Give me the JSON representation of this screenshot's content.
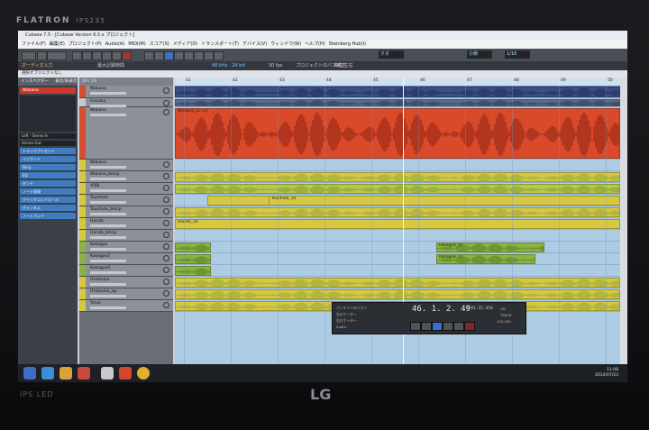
{
  "bezel": {
    "brand": "FLATRON",
    "model": "IPS235",
    "lower_left": "IPS LED",
    "logo": "LG"
  },
  "window": {
    "title": "Cubase 7.5 - [Cubase Version 6.5.x プロジェクト]"
  },
  "menu": [
    "ファイル(F)",
    "編集(E)",
    "プロジェクト(P)",
    "Audio(A)",
    "MIDI(M)",
    "スコア(S)",
    "メディア(D)",
    "トランスポート(T)",
    "デバイス(V)",
    "ウィンドウ(W)",
    "ヘルプ(H)",
    "Steinberg Hub(I)"
  ],
  "toolbar": {
    "snap": "クオ",
    "quantize": "1/16",
    "tempo_mode": "小節"
  },
  "infobar": {
    "record_label": "オーディオ入力",
    "rate": "48 kHz - 24 bit",
    "fps": "30 fps",
    "status1": "最大記録時間",
    "status2": "プロジェクトのパン補正",
    "status3": "等位/左右"
  },
  "statusline": "選択オブジェクトなし",
  "inspector": {
    "header": "インスペクター",
    "tab": "表示/非表示",
    "track": "Wakana",
    "slots": [
      "Left - Stereo In",
      "Stereo Out"
    ],
    "sections": [
      "トラックプリセット",
      "インサート",
      "Strip",
      "EQ",
      "センド",
      "ノート表現",
      "クイックコントロール",
      "チャンネル",
      "ノートパッド"
    ]
  },
  "tracklist": {
    "header": "29 / 29"
  },
  "tracks": [
    {
      "name": "Wakana",
      "color": "#d44d2e",
      "h": 14
    },
    {
      "name": "Inacaku",
      "color": "#c9c9c9",
      "h": 10
    },
    {
      "name": "Wakana",
      "color": "#d44d2e",
      "h": 58
    },
    {
      "name": "Wakana",
      "color": "#d6c843",
      "h": 13
    },
    {
      "name": "Wakana_bmsp",
      "color": "#d6c843",
      "h": 13
    },
    {
      "name": "YOBI",
      "color": "#d6c843",
      "h": 13
    },
    {
      "name": "Touchida",
      "color": "#d6c843",
      "h": 13
    },
    {
      "name": "Touchida_bmsp",
      "color": "#d6c843",
      "h": 13
    },
    {
      "name": "Honda",
      "color": "#d6c843",
      "h": 13
    },
    {
      "name": "Honda_bmsp",
      "color": "#d6c843",
      "h": 13
    },
    {
      "name": "Kakegoe",
      "color": "#8cb241",
      "h": 13
    },
    {
      "name": "Kakegoe2",
      "color": "#8cb241",
      "h": 13
    },
    {
      "name": "Kakegoe4",
      "color": "#8cb241",
      "h": 13
    },
    {
      "name": "Hiratsuka",
      "color": "#d6c843",
      "h": 13
    },
    {
      "name": "Hiratsuka_op",
      "color": "#d6c843",
      "h": 13
    },
    {
      "name": "Yanai",
      "color": "#d6c843",
      "h": 13
    }
  ],
  "ruler": [
    "41",
    "42",
    "43",
    "44",
    "45",
    "46",
    "47",
    "48",
    "49",
    "50"
  ],
  "clips": [
    {
      "label": "Wakana_15 (2)",
      "color": "#d94a2a"
    },
    {
      "label": "Tsuchida_10",
      "color": "#d6c843"
    },
    {
      "label": "Honda_16",
      "color": "#d6c843"
    },
    {
      "label": "kakegoe_05",
      "color": "#8cb241"
    },
    {
      "label": "kakegoe_07",
      "color": "#8cb241"
    }
  ],
  "transport": {
    "position": "46. 1. 2. 49",
    "time": "0:01:35.450",
    "labels": [
      "パンチインのリオン",
      "左ロケーター",
      "右ロケーター",
      "Audio",
      "TRACK"
    ],
    "click": "ON",
    "tempo": "120.000"
  },
  "taskbar": {
    "icons": [
      "windows-start",
      "internet-explorer",
      "file-explorer",
      "media",
      "cubase-app",
      "chrome",
      "other-app"
    ],
    "time": "11:08",
    "date": "2014/07/23"
  }
}
